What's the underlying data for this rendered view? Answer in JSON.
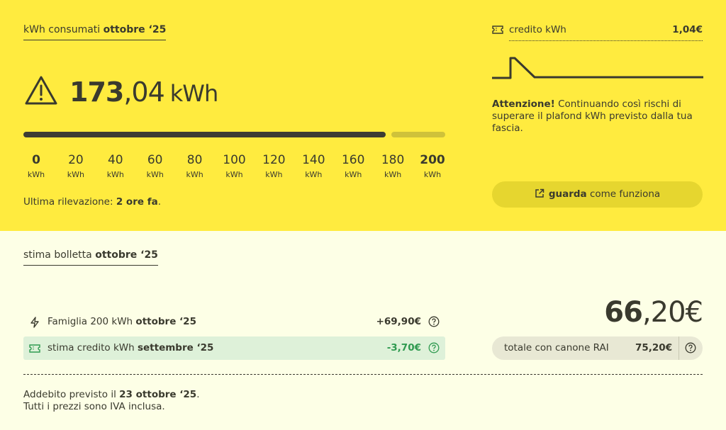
{
  "consumption": {
    "title_prefix": "kWh consumati",
    "title_period": "ottobre ‘25",
    "value_int": "173",
    "value_dec": ",04",
    "value_unit": "kWh",
    "progress_fraction": 0.8652,
    "scale": [
      {
        "value": "0",
        "unit": "kWh"
      },
      {
        "value": "20",
        "unit": "kWh"
      },
      {
        "value": "40",
        "unit": "kWh"
      },
      {
        "value": "60",
        "unit": "kWh"
      },
      {
        "value": "80",
        "unit": "kWh"
      },
      {
        "value": "100",
        "unit": "kWh"
      },
      {
        "value": "120",
        "unit": "kWh"
      },
      {
        "value": "140",
        "unit": "kWh"
      },
      {
        "value": "160",
        "unit": "kWh"
      },
      {
        "value": "180",
        "unit": "kWh"
      },
      {
        "value": "200",
        "unit": "kWh"
      }
    ],
    "last_reading_prefix": "Ultima rilevazione:",
    "last_reading_value": "2 ore fa",
    "last_reading_suffix": ".",
    "warning_icon": "warning-triangle-icon"
  },
  "credit": {
    "label": "credito kWh",
    "value": "1,04€",
    "icon": "ticket-icon"
  },
  "attention": {
    "bold": "Attenzione!",
    "text": " Continuando così rischi di superare il plafond kWh previsto dalla tua fascia."
  },
  "how_button": {
    "bold": "guarda",
    "text": " come funziona",
    "icon": "external-link-icon"
  },
  "bill": {
    "title_prefix": "stima bolletta",
    "title_period": "ottobre ‘25",
    "items": [
      {
        "icon": "bolt-icon",
        "label": "Famiglia 200 kWh",
        "period": "ottobre ‘25",
        "amount": "+69,90€"
      },
      {
        "icon": "ticket-icon",
        "label": "stima credito kWh",
        "period": "settembre ‘25",
        "amount": "-3,70€"
      }
    ],
    "total_int": "66",
    "total_dec": ",20€",
    "rai_label": "totale con canone RAI",
    "rai_value": "75,20€",
    "footer_line1_prefix": "Addebito previsto il",
    "footer_line1_date": "23 ottobre ‘25",
    "footer_line1_suffix": ".",
    "footer_line2": "Tutti i prezzi sono IVA inclusa."
  },
  "colors": {
    "top_bg": "#ffeb3f",
    "bottom_bg": "#fdffe6",
    "text": "#3a3a2e",
    "credit_row_bg": "#def1d9",
    "credit_amount": "#2f9a50"
  }
}
